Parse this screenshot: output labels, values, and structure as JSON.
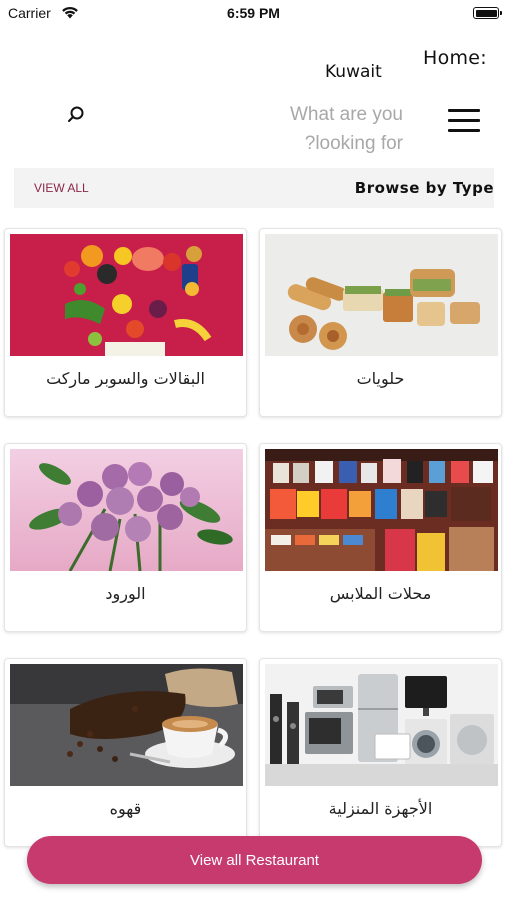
{
  "status_bar": {
    "carrier": "Carrier",
    "time": "6:59 PM"
  },
  "header": {
    "title": "Home:",
    "location": "Kuwait"
  },
  "search": {
    "placeholder": "What are you looking for?"
  },
  "browse": {
    "title": "Browse by Type",
    "view_all": "VIEW ALL"
  },
  "categories": [
    {
      "label": "البقالات والسوبر ماركت",
      "icon": "groceries-image"
    },
    {
      "label": "حلويات",
      "icon": "sweets-image"
    },
    {
      "label": "الورود",
      "icon": "roses-image"
    },
    {
      "label": "محلات الملابس",
      "icon": "clothing-store-image"
    },
    {
      "label": "قهوه",
      "icon": "coffee-image"
    },
    {
      "label": "الأجهزة المنزلية",
      "icon": "home-appliances-image"
    }
  ],
  "bottom_button": {
    "label": "View all Restaurant"
  },
  "colors": {
    "accent": "#c63a6e",
    "view_all": "#8a2847",
    "browse_bar": "#f3f3f3"
  }
}
